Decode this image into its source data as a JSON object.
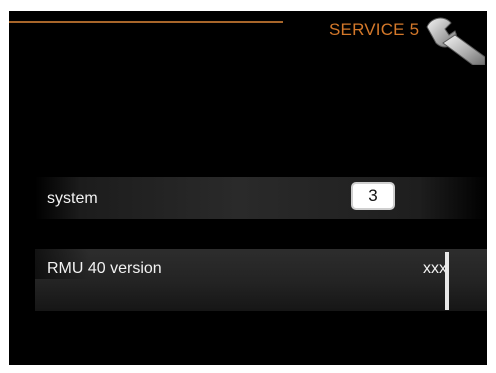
{
  "header": {
    "title": "SERVICE 5",
    "icon": "wrench-icon",
    "accent_color": "#d4782a"
  },
  "rows": [
    {
      "label": "system",
      "value": "3"
    },
    {
      "label": "RMU 40 version",
      "value": "xxx"
    }
  ]
}
